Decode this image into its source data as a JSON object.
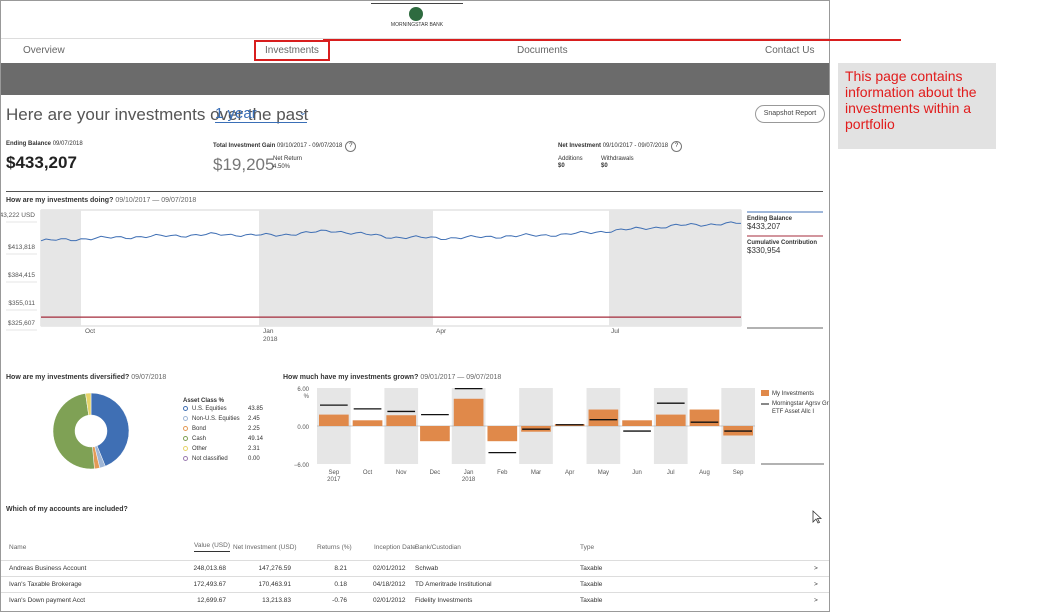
{
  "logo": {
    "brand": "MORNINGSTAR BANK"
  },
  "nav": {
    "items": [
      "Overview",
      "Investments",
      "Documents",
      "Contact Us"
    ]
  },
  "headline": "Here are your investments over the past",
  "period": "1 year",
  "snapshot_label": "Snapshot Report",
  "summary": {
    "ending_label": "Ending Balance",
    "ending_date": "09/07/2018",
    "ending_value": "$433,207",
    "gain_label": "Total Investment Gain",
    "gain_dates": "09/10/2017 - 09/07/2018",
    "gain_value": "$19,205",
    "net_return_label": "Net Return",
    "net_return_value": "4.50%",
    "net_inv_label": "Net Investment",
    "net_inv_dates": "09/10/2017 - 09/07/2018",
    "additions_label": "Additions",
    "additions_value": "$0",
    "withdrawals_label": "Withdrawals",
    "withdrawals_value": "$0"
  },
  "doing": {
    "title": "How are my investments doing?",
    "dates": "09/10/2017 — 09/07/2018",
    "y_ticks": [
      "$443,222 USD",
      "$413,818",
      "$384,415",
      "$355,011",
      "$325,607"
    ],
    "x_ticks": [
      "Oct",
      "Jan 2018",
      "Apr",
      "Jul"
    ],
    "legend_ending_label": "Ending Balance",
    "legend_ending_value": "$433,207",
    "legend_contrib_label": "Cumulative Contribution",
    "legend_contrib_value": "$330,954"
  },
  "diversified": {
    "title": "How are my investments diversified?",
    "date": "09/07/2018",
    "header": "Asset Class %",
    "items": [
      {
        "label": "U.S. Equities",
        "value": "43.85",
        "color": "#3f6fb4"
      },
      {
        "label": "Non-U.S. Equities",
        "value": "2.45",
        "color": "#9fb6d6"
      },
      {
        "label": "Bond",
        "value": "2.25",
        "color": "#e39a56"
      },
      {
        "label": "Cash",
        "value": "49.14",
        "color": "#7fa155"
      },
      {
        "label": "Other",
        "value": "2.31",
        "color": "#e7d46a"
      },
      {
        "label": "Not classified",
        "value": "0.00",
        "color": "#9a7bb0"
      }
    ]
  },
  "grown": {
    "title": "How much have my investments grown?",
    "dates": "09/01/2017 — 09/07/2018",
    "y_ticks": [
      "6.00 %",
      "0.00",
      "-6.00"
    ],
    "legend_mine": "My Investments",
    "legend_bench": "Morningstar Agrsv Gr ETF Asset Allc I"
  },
  "chart_data": [
    {
      "type": "line",
      "title": "How are my investments doing?",
      "x": [
        "Sep 2017",
        "Oct",
        "Nov",
        "Dec",
        "Jan 2018",
        "Feb",
        "Mar",
        "Apr",
        "May",
        "Jun",
        "Jul",
        "Aug",
        "Sep 2018"
      ],
      "series": [
        {
          "name": "Ending Balance",
          "values": [
            414000,
            417000,
            419000,
            421000,
            420000,
            425000,
            418000,
            417000,
            419000,
            421000,
            426000,
            431000,
            433207
          ],
          "color": "#3f6fb4"
        },
        {
          "name": "Cumulative Contribution",
          "values": [
            330954,
            330954,
            330954,
            330954,
            330954,
            330954,
            330954,
            330954,
            330954,
            330954,
            330954,
            330954,
            330954
          ],
          "color": "#a42b3b"
        }
      ],
      "ylim": [
        325607,
        443222
      ]
    },
    {
      "type": "pie",
      "title": "How are my investments diversified?",
      "categories": [
        "U.S. Equities",
        "Non-U.S. Equities",
        "Bond",
        "Cash",
        "Other",
        "Not classified"
      ],
      "values": [
        43.85,
        2.45,
        2.25,
        49.14,
        2.31,
        0.0
      ]
    },
    {
      "type": "bar",
      "title": "How much have my investments grown?",
      "categories": [
        "Sep 2017",
        "Oct",
        "Nov",
        "Dec",
        "Jan 2018",
        "Feb",
        "Mar",
        "Apr",
        "May",
        "Jun",
        "Jul",
        "Aug",
        "Sep"
      ],
      "series": [
        {
          "name": "My Investments",
          "values": [
            1.8,
            0.9,
            1.7,
            -2.4,
            4.3,
            -2.4,
            -0.9,
            0.3,
            2.6,
            0.9,
            1.8,
            2.6,
            -1.5
          ]
        },
        {
          "name": "Morningstar Agrsv Gr ETF Asset Allc I",
          "values": [
            3.3,
            2.7,
            2.3,
            1.8,
            5.9,
            -4.2,
            -0.5,
            0.2,
            1.0,
            -0.8,
            3.6,
            0.6,
            -0.8
          ]
        }
      ],
      "ylim": [
        -6,
        6
      ]
    }
  ],
  "accounts": {
    "title": "Which of my accounts are included?",
    "headers": [
      "Name",
      "Value (USD)",
      "Net Investment (USD)",
      "Returns (%)",
      "Inception Date",
      "Bank/Custodian",
      "Type"
    ],
    "rows": [
      [
        "Andreas Business Account",
        "248,013.68",
        "147,276.59",
        "8.21",
        "02/01/2012",
        "Schwab",
        "Taxable"
      ],
      [
        "Ivan's Taxable Brokerage",
        "172,493.67",
        "170,463.91",
        "0.18",
        "04/18/2012",
        "TD Ameritrade Institutional",
        "Taxable"
      ],
      [
        "Ivan's Down payment Acct",
        "12,699.67",
        "13,213.83",
        "-0.76",
        "02/01/2012",
        "Fidelity Investments",
        "Taxable"
      ]
    ]
  },
  "callout": "This page contains information about the investments within a portfolio",
  "colors": {
    "accent": "#3a6fb7",
    "callout_red": "#e11b1b",
    "band": "#6b6b6b"
  }
}
